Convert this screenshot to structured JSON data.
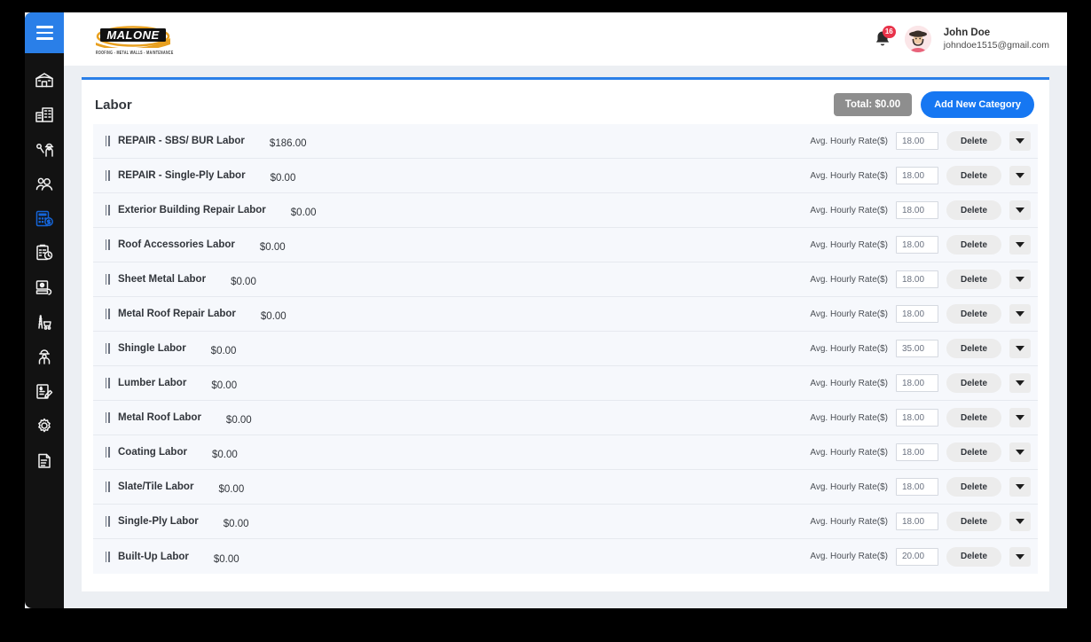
{
  "brand": {
    "logo_text": "MALONE",
    "logo_tagline": "ROOFING - METAL WALLS - MAINTENANCE"
  },
  "topbar": {
    "menu_toggle_label": "menu",
    "notifications_count": "16",
    "user": {
      "name": "John Doe",
      "email": "johndoe1515@gmail.com"
    }
  },
  "sidebar": {
    "items": [
      {
        "icon": "barn-home-icon",
        "active": false
      },
      {
        "icon": "office-building-icon",
        "active": false
      },
      {
        "icon": "inspector-icon",
        "active": false
      },
      {
        "icon": "users-icon",
        "active": false
      },
      {
        "icon": "calculator-dollar-icon",
        "active": true
      },
      {
        "icon": "clipboard-clock-icon",
        "active": false
      },
      {
        "icon": "payment-icon",
        "active": false
      },
      {
        "icon": "ladder-cart-icon",
        "active": false
      },
      {
        "icon": "worker-helmet-icon",
        "active": false
      },
      {
        "icon": "invoice-edit-icon",
        "active": false
      },
      {
        "icon": "gear-icon",
        "active": false
      },
      {
        "icon": "document-note-icon",
        "active": false
      }
    ]
  },
  "page": {
    "title": "Labor",
    "total_label": "Total: $0.00",
    "add_category_label": "Add New Category",
    "rate_label": "Avg. Hourly Rate($)",
    "delete_label": "Delete",
    "expand_label": "expand",
    "accent_color": "#2a7fe8",
    "total_pill_color": "#8e8e8e"
  },
  "rows": [
    {
      "name": "REPAIR - SBS/ BUR Labor",
      "price": "$186.00",
      "rate": "18.00"
    },
    {
      "name": "REPAIR - Single-Ply Labor",
      "price": "$0.00",
      "rate": "18.00"
    },
    {
      "name": "Exterior Building Repair Labor",
      "price": "$0.00",
      "rate": "18.00"
    },
    {
      "name": "Roof Accessories Labor",
      "price": "$0.00",
      "rate": "18.00"
    },
    {
      "name": "Sheet Metal Labor",
      "price": "$0.00",
      "rate": "18.00"
    },
    {
      "name": "Metal Roof Repair Labor",
      "price": "$0.00",
      "rate": "18.00"
    },
    {
      "name": "Shingle Labor",
      "price": "$0.00",
      "rate": "35.00"
    },
    {
      "name": "Lumber Labor",
      "price": "$0.00",
      "rate": "18.00"
    },
    {
      "name": "Metal Roof Labor",
      "price": "$0.00",
      "rate": "18.00"
    },
    {
      "name": "Coating Labor",
      "price": "$0.00",
      "rate": "18.00"
    },
    {
      "name": "Slate/Tile Labor",
      "price": "$0.00",
      "rate": "18.00"
    },
    {
      "name": "Single-Ply Labor",
      "price": "$0.00",
      "rate": "18.00"
    },
    {
      "name": "Built-Up Labor",
      "price": "$0.00",
      "rate": "20.00"
    }
  ]
}
